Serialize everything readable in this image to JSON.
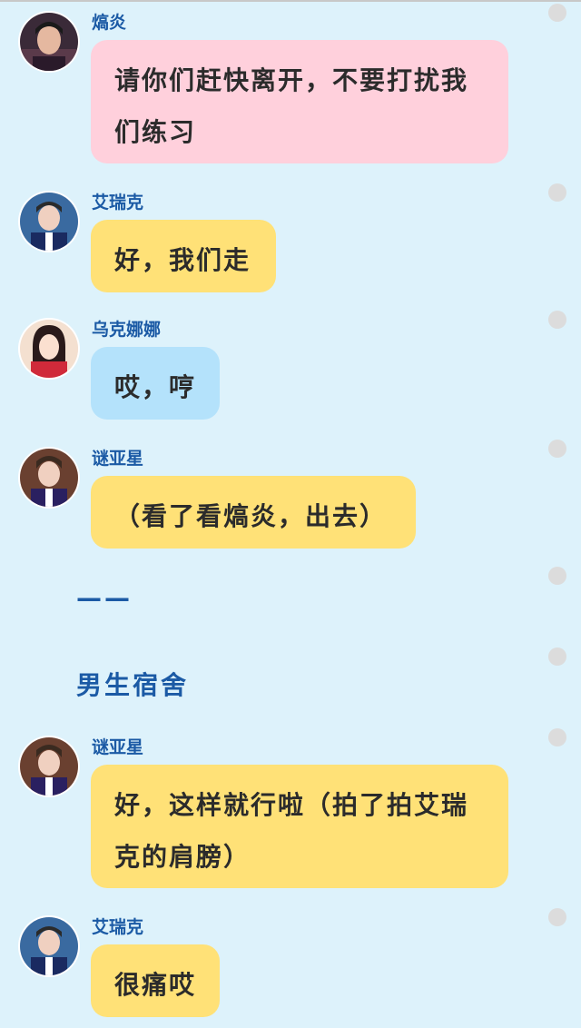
{
  "messages": [
    {
      "speaker": "熇炎",
      "text": "请你们赶快离开，不要打扰我们练习",
      "line1": "请你们赶快离开，不要打扰我",
      "line2": "们练习",
      "color": "pink"
    },
    {
      "speaker": "艾瑞克",
      "text": "好，我们走",
      "color": "yellow"
    },
    {
      "speaker": "乌克娜娜",
      "text": "哎，哼",
      "color": "blue"
    },
    {
      "speaker": "谜亚星",
      "text": "（看了看熇炎，出去）",
      "color": "yellow"
    },
    {
      "speaker": "谜亚星",
      "text": "好，这样就行啦（拍了拍艾瑞克的肩膀）",
      "line1": "好，这样就行啦（拍了拍艾瑞",
      "line2": "克的肩膀）",
      "color": "yellow"
    },
    {
      "speaker": "艾瑞克",
      "text": "很痛哎",
      "color": "yellow"
    }
  ],
  "narration": {
    "divider": "——",
    "scene": "男生宿舍"
  },
  "colors": {
    "background": "#ddf2fb",
    "name": "#1b5aa5",
    "pink": "#ffd0dc",
    "yellow": "#ffe177",
    "blue": "#b4e2fb"
  },
  "icons": {
    "avatar": "avatar-icon",
    "dot": "dot-icon"
  }
}
